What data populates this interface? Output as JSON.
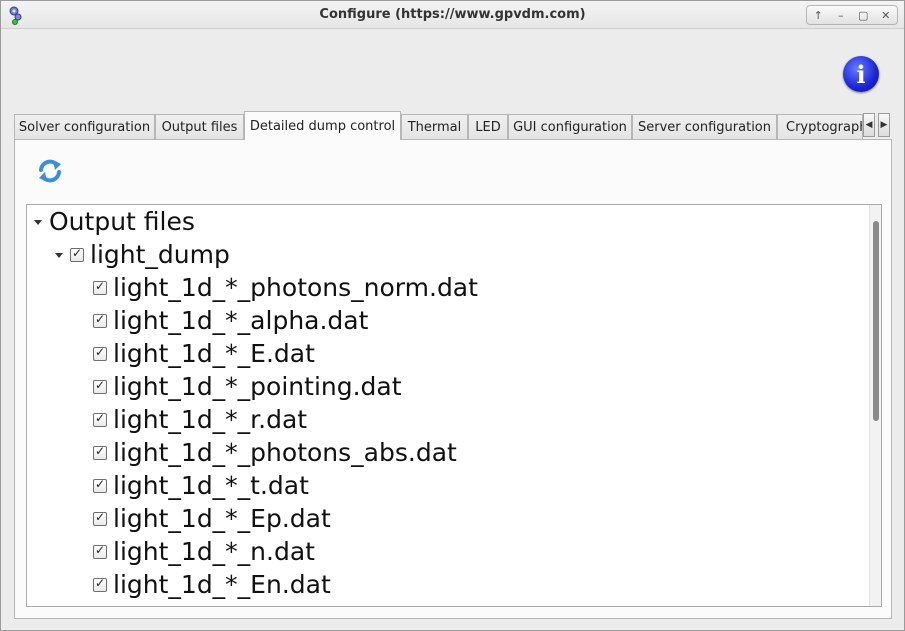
{
  "window": {
    "title": "Configure (https://www.gpvdm.com)"
  },
  "wm": {
    "up": "↑",
    "minimize": "–",
    "maximize": "▢",
    "close": "✕"
  },
  "info_icon_glyph": "i",
  "tabs": [
    {
      "label": "Solver configuration",
      "active": false
    },
    {
      "label": "Output files",
      "active": false
    },
    {
      "label": "Detailed dump control",
      "active": true
    },
    {
      "label": "Thermal",
      "active": false
    },
    {
      "label": "LED",
      "active": false
    },
    {
      "label": "GUI configuration",
      "active": false
    },
    {
      "label": "Server configuration",
      "active": false
    },
    {
      "label": "Cryptograph",
      "active": false
    }
  ],
  "tab_scroll": {
    "left": "◀",
    "right": "▶"
  },
  "tree": {
    "root": {
      "label": "Output files",
      "expanded": true
    },
    "group": {
      "label": "light_dump",
      "expanded": true,
      "checked": true
    },
    "items": [
      {
        "label": "light_1d_*_photons_norm.dat",
        "checked": true
      },
      {
        "label": "light_1d_*_alpha.dat",
        "checked": true
      },
      {
        "label": "light_1d_*_E.dat",
        "checked": true
      },
      {
        "label": "light_1d_*_pointing.dat",
        "checked": true
      },
      {
        "label": "light_1d_*_r.dat",
        "checked": true
      },
      {
        "label": "light_1d_*_photons_abs.dat",
        "checked": true
      },
      {
        "label": "light_1d_*_t.dat",
        "checked": true
      },
      {
        "label": "light_1d_*_Ep.dat",
        "checked": true
      },
      {
        "label": "light_1d_*_n.dat",
        "checked": true
      },
      {
        "label": "light_1d_*_En.dat",
        "checked": true
      }
    ]
  },
  "colors": {
    "info_blue": "#1a24d6",
    "refresh_blue": "#3a8fd6"
  }
}
